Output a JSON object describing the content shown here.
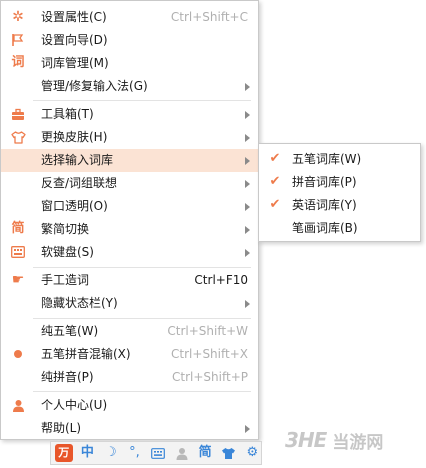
{
  "menu": {
    "items": [
      {
        "label": "设置属性(C)",
        "shortcut": "Ctrl+Shift+C",
        "icon": "gear-icon"
      },
      {
        "label": "设置向导(D)",
        "icon": "flag-icon"
      },
      {
        "label": "词库管理(M)",
        "icon": "dictionary-icon"
      },
      {
        "label": "管理/修复输入法(G)",
        "submenu": true
      },
      {
        "label": "工具箱(T)",
        "icon": "toolbox-icon",
        "submenu": true
      },
      {
        "label": "更换皮肤(H)",
        "icon": "shirt-icon",
        "submenu": true
      },
      {
        "label": "选择输入词库",
        "submenu": true,
        "highlighted": true
      },
      {
        "label": "反查/词组联想",
        "submenu": true
      },
      {
        "label": "窗口透明(O)",
        "submenu": true
      },
      {
        "label": "繁简切换",
        "icon": "traditional-char-icon",
        "submenu": true
      },
      {
        "label": "软键盘(S)",
        "icon": "keyboard-icon",
        "submenu": true
      },
      {
        "label": "手工造词",
        "shortcut": "Ctrl+F10",
        "icon": "hand-icon"
      },
      {
        "label": "隐藏状态栏(Y)",
        "submenu": true
      },
      {
        "label": "纯五笔(W)",
        "shortcut": "Ctrl+Shift+W"
      },
      {
        "label": "五笔拼音混输(X)",
        "shortcut": "Ctrl+Shift+X",
        "icon": "selected-dot-icon"
      },
      {
        "label": "纯拼音(P)",
        "shortcut": "Ctrl+Shift+P"
      },
      {
        "label": "个人中心(U)",
        "icon": "person-icon"
      },
      {
        "label": "帮助(L)",
        "submenu": true
      }
    ]
  },
  "submenu": {
    "items": [
      {
        "label": "五笔词库(W)",
        "checked": true
      },
      {
        "label": "拼音词库(P)",
        "checked": true
      },
      {
        "label": "英语词库(Y)",
        "checked": true
      },
      {
        "label": "笔画词库(B)",
        "checked": false
      }
    ]
  },
  "toolbar": {
    "mode": "中",
    "simplified": "简"
  },
  "watermark": {
    "brand": "当游网"
  },
  "colors": {
    "accent": "#ee7b4b",
    "highlight": "#fbe3d4",
    "toolbar_icon": "#3a86d8"
  }
}
